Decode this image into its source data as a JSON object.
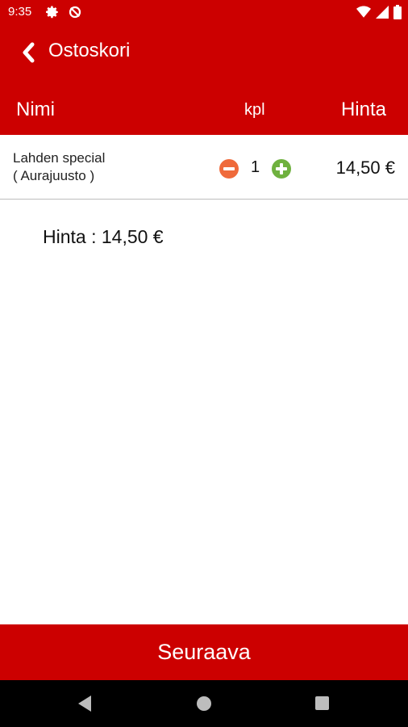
{
  "status_bar": {
    "time": "9:35",
    "icons": [
      "gear-icon",
      "no-sync-icon",
      "wifi-icon",
      "signal-icon",
      "battery-icon"
    ]
  },
  "app_bar": {
    "title": "Ostoskori",
    "back_icon": "chevron-left-icon"
  },
  "table_header": {
    "name": "Nimi",
    "quantity": "kpl",
    "price": "Hinta"
  },
  "cart": {
    "items": [
      {
        "name_line1": "Lahden special",
        "name_line2": "( Aurajuusto )",
        "quantity": "1",
        "price": "14,50 €"
      }
    ]
  },
  "total": {
    "text": "Hinta : 14,50 €"
  },
  "next_button": {
    "label": "Seuraava"
  },
  "colors": {
    "primary": "#cc0000",
    "minus": "#ef6a3b",
    "plus": "#6fb13f"
  }
}
